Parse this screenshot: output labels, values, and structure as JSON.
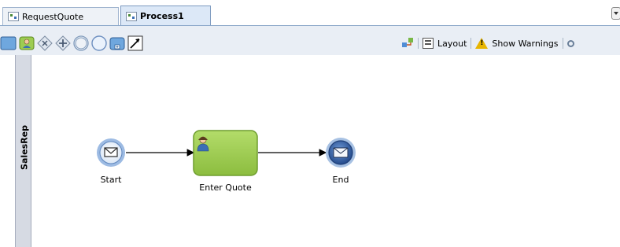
{
  "tabs": [
    {
      "label": "RequestQuote",
      "active": false
    },
    {
      "label": "Process1",
      "active": true
    }
  ],
  "toolbar": {
    "tools": [
      {
        "icon": "swimlane-icon"
      },
      {
        "icon": "user-task-icon"
      },
      {
        "icon": "exclusive-gateway-icon"
      },
      {
        "icon": "parallel-gateway-icon"
      },
      {
        "icon": "intermediate-event-icon"
      },
      {
        "icon": "start-event-icon"
      },
      {
        "icon": "subprocess-icon"
      },
      {
        "icon": "connector-icon"
      }
    ],
    "layout_label": "Layout",
    "warnings_label": "Show Warnings"
  },
  "lane": {
    "label": "SalesRep"
  },
  "process": {
    "start_label": "Start",
    "task_label": "Enter Quote",
    "end_label": "End"
  },
  "colors": {
    "task_fill": "#9dcc52",
    "task_border": "#6e9d2e",
    "event_ring": "#7fa8d6",
    "event_fill": "#e7f0fb",
    "end_fill": "#3d6aae"
  }
}
